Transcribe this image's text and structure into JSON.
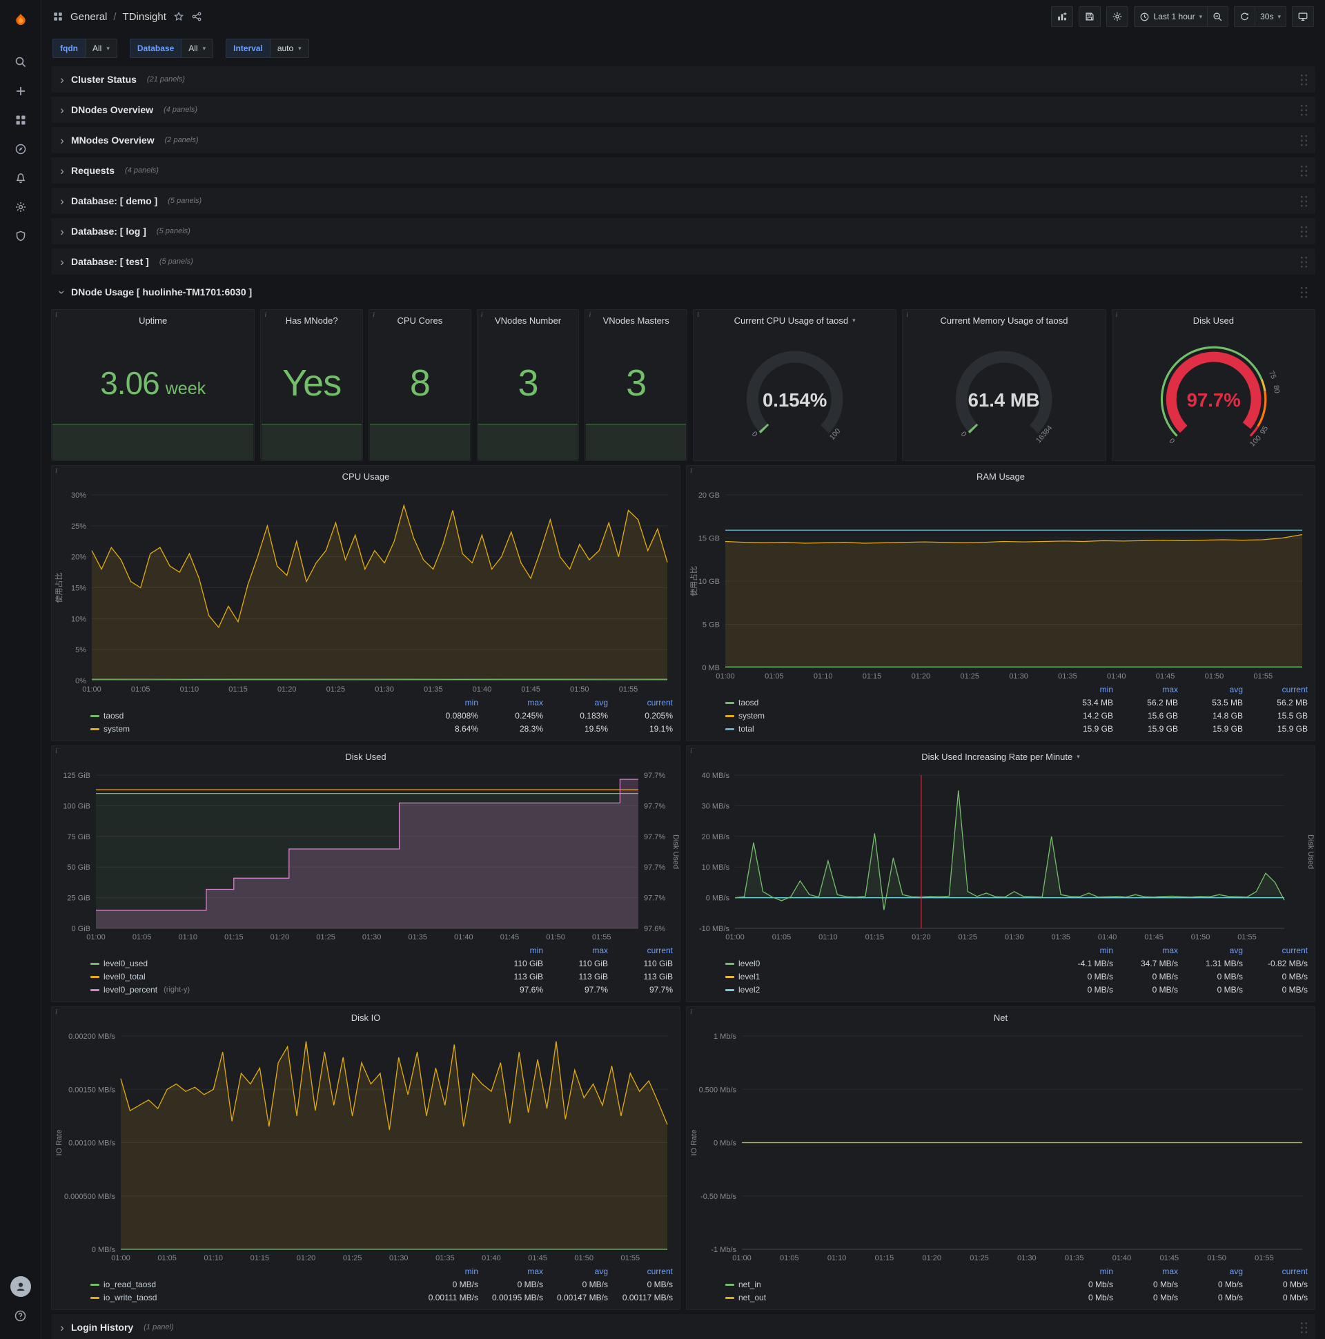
{
  "colors": {
    "green": "#73bf69",
    "yellow": "#e5ac0e",
    "blue": "#64b0c8",
    "cyan": "#6ed0e0",
    "orange": "#ff780a",
    "gold": "#eab839",
    "pink": "#d683ce",
    "red": "#e02f44",
    "header_blue": "#6e9fff",
    "axis_text": "#878b91"
  },
  "icons": {
    "chevron_right": "›",
    "caret_down": "▾",
    "panel_info": "i",
    "help": "?"
  },
  "navbar": {
    "breadcrumb_section": "General",
    "breadcrumb_sep": "/",
    "breadcrumb_page": "TDinsight",
    "time_range": "Last 1 hour",
    "refresh_interval": "30s"
  },
  "variables": [
    {
      "label": "fqdn",
      "value": "All"
    },
    {
      "label": "Database",
      "value": "All"
    },
    {
      "label": "Interval",
      "value": "auto"
    }
  ],
  "collapsed_rows": [
    {
      "title": "Cluster Status",
      "count": "(21 panels)"
    },
    {
      "title": "DNodes Overview",
      "count": "(4 panels)"
    },
    {
      "title": "MNodes Overview",
      "count": "(2 panels)"
    },
    {
      "title": "Requests",
      "count": "(4 panels)"
    },
    {
      "title": "Database: [ demo ]",
      "count": "(5 panels)"
    },
    {
      "title": "Database: [ log ]",
      "count": "(5 panels)"
    },
    {
      "title": "Database: [ test ]",
      "count": "(5 panels)"
    }
  ],
  "expanded_row": {
    "title": "DNode Usage [ huolinhe-TM1701:6030 ]"
  },
  "bottom_row": {
    "title": "Login History",
    "count": "(1 panel)"
  },
  "stats": [
    {
      "title": "Uptime",
      "value": "3.06",
      "unit": "week"
    },
    {
      "title": "Has MNode?",
      "value": "Yes",
      "unit": ""
    },
    {
      "title": "CPU Cores",
      "value": "8",
      "unit": ""
    },
    {
      "title": "VNodes Number",
      "value": "3",
      "unit": ""
    },
    {
      "title": "VNodes Masters",
      "value": "3",
      "unit": ""
    }
  ],
  "gauges": [
    {
      "title": "Current CPU Usage of taosd",
      "caret": true,
      "style": "simple",
      "value": "0.154%",
      "min_label": "0",
      "max_label": "100",
      "percent": 0.154,
      "value_color": "#d8d9da"
    },
    {
      "title": "Current Memory Usage of taosd",
      "caret": false,
      "style": "simple",
      "value": "61.4 MB",
      "min_label": "0",
      "max_label": "16384",
      "percent": 0.375,
      "value_color": "#d8d9da"
    },
    {
      "title": "Disk Used",
      "caret": false,
      "style": "threshold",
      "value": "97.7%",
      "percent": 97.7,
      "value_color": "#e02f44",
      "scale_labels": [
        {
          "v": 0,
          "t": "0"
        },
        {
          "v": 75,
          "t": "75"
        },
        {
          "v": 80,
          "t": "80"
        },
        {
          "v": 95,
          "t": "95"
        },
        {
          "v": 100,
          "t": "100"
        }
      ],
      "ring": [
        {
          "from": 0,
          "to": 75,
          "color": "#73bf69"
        },
        {
          "from": 75,
          "to": 80,
          "color": "#eab839"
        },
        {
          "from": 80,
          "to": 95,
          "color": "#ff780a"
        },
        {
          "from": 95,
          "to": 100,
          "color": "#e02f44"
        }
      ]
    }
  ],
  "charts": {
    "type": "line",
    "x_ticks": [
      "01:00",
      "01:05",
      "01:10",
      "01:15",
      "01:20",
      "01:25",
      "01:30",
      "01:35",
      "01:40",
      "01:45",
      "01:50",
      "01:55"
    ],
    "panels": [
      {
        "title": "CPU Usage",
        "y_label": "使用占比",
        "ml": 58,
        "mr": 18,
        "y_range": [
          0,
          30
        ],
        "y_ticks": [
          "30%",
          "25%",
          "20%",
          "15%",
          "10%",
          "5%",
          "0%"
        ],
        "series": [
          {
            "name": "system",
            "color": "#e5ac0e",
            "fill": 0.12,
            "data": [
              21,
              18,
              21.5,
              19.5,
              16,
              15,
              20.5,
              21.5,
              18.5,
              17.5,
              20.5,
              16.5,
              10.5,
              8.6,
              12,
              9.5,
              15.5,
              20,
              25,
              18.5,
              17,
              22.5,
              16,
              19,
              21,
              25.5,
              19.5,
              23.5,
              18,
              21,
              19,
              22.5,
              28.3,
              23,
              19.5,
              18,
              22,
              27.5,
              20.5,
              19,
              23.5,
              18,
              20,
              24,
              19,
              16.5,
              21,
              26,
              20,
              18,
              22,
              19.5,
              21,
              25.5,
              20,
              27.5,
              26,
              21,
              24.5,
              19.1
            ]
          },
          {
            "name": "taosd",
            "color": "#73bf69",
            "data": [
              0.2,
              0.21,
              0.19,
              0.2,
              0.2,
              0.21,
              0.2,
              0.19,
              0.2,
              0.2,
              0.21,
              0.2
            ]
          }
        ],
        "legend": {
          "cols": [
            "min",
            "max",
            "avg",
            "current"
          ],
          "rows": [
            {
              "name": "taosd",
              "color": "#73bf69",
              "vals": [
                "0.0808%",
                "0.245%",
                "0.183%",
                "0.205%"
              ]
            },
            {
              "name": "system",
              "color": "#e5ac0e",
              "vals": [
                "8.64%",
                "28.3%",
                "19.5%",
                "19.1%"
              ]
            }
          ]
        }
      },
      {
        "title": "RAM Usage",
        "y_label": "使用占比",
        "ml": 56,
        "mr": 18,
        "y_range": [
          0,
          20
        ],
        "y_ticks": [
          "20 GB",
          "15 GB",
          "10 GB",
          "5 GB",
          "0 MB"
        ],
        "series": [
          {
            "name": "system",
            "color": "#e5ac0e",
            "fill": 0.12,
            "data": [
              14.6,
              14.5,
              14.45,
              14.5,
              14.4,
              14.45,
              14.5,
              14.4,
              14.45,
              14.5,
              14.55,
              14.5,
              14.45,
              14.5,
              14.6,
              14.55,
              14.6,
              14.65,
              14.6,
              14.7,
              14.65,
              14.7,
              14.75,
              14.7,
              14.75,
              14.8,
              14.75,
              14.8,
              15.0,
              15.4
            ]
          },
          {
            "name": "total",
            "color": "#64b0c8",
            "data": [
              15.9,
              15.9
            ]
          },
          {
            "name": "taosd",
            "color": "#73bf69",
            "data": [
              0.055,
              0.055
            ]
          }
        ],
        "legend": {
          "cols": [
            "min",
            "max",
            "avg",
            "current"
          ],
          "rows": [
            {
              "name": "taosd",
              "color": "#73bf69",
              "vals": [
                "53.4 MB",
                "56.2 MB",
                "53.5 MB",
                "56.2 MB"
              ]
            },
            {
              "name": "system",
              "color": "#e5ac0e",
              "vals": [
                "14.2 GB",
                "15.6 GB",
                "14.8 GB",
                "15.5 GB"
              ]
            },
            {
              "name": "total",
              "color": "#64b0c8",
              "vals": [
                "15.9 GB",
                "15.9 GB",
                "15.9 GB",
                "15.9 GB"
              ]
            }
          ]
        }
      },
      {
        "title": "Disk Used",
        "ml": 64,
        "mr": 60,
        "y_range": [
          0,
          125
        ],
        "y_ticks": [
          "125 GiB",
          "100 GiB",
          "75 GiB",
          "50 GiB",
          "25 GiB",
          "0 GiB"
        ],
        "y2_range": [
          97.6,
          97.71
        ],
        "y2_ticks": [
          "97.7%",
          "97.7%",
          "97.7%",
          "97.7%",
          "97.7%",
          "97.6%"
        ],
        "y2_label": "Disk Used",
        "series": [
          {
            "name": "level0_used",
            "color": "#73bf69",
            "fill": 0.08,
            "data": [
              110,
              110
            ]
          },
          {
            "name": "level0_total",
            "color": "#e5ac0e",
            "data": [
              113,
              113
            ]
          },
          {
            "name": "level0_percent",
            "color": "#d683ce",
            "axis": "y2",
            "fill": 0.22,
            "step": true,
            "data": [
              97.613,
              97.613,
              97.613,
              97.613,
              97.613,
              97.613,
              97.613,
              97.613,
              97.613,
              97.613,
              97.613,
              97.613,
              97.628,
              97.628,
              97.628,
              97.636,
              97.636,
              97.636,
              97.636,
              97.636,
              97.636,
              97.657,
              97.657,
              97.657,
              97.657,
              97.657,
              97.657,
              97.657,
              97.657,
              97.657,
              97.657,
              97.657,
              97.657,
              97.69,
              97.69,
              97.69,
              97.69,
              97.69,
              97.69,
              97.69,
              97.69,
              97.69,
              97.69,
              97.69,
              97.69,
              97.69,
              97.69,
              97.69,
              97.69,
              97.69,
              97.69,
              97.69,
              97.69,
              97.69,
              97.69,
              97.69,
              97.69,
              97.707,
              97.707,
              97.707
            ]
          }
        ],
        "legend": {
          "cols": [
            "min",
            "max",
            "current"
          ],
          "rows": [
            {
              "name": "level0_used",
              "color": "#73bf69",
              "vals": [
                "110 GiB",
                "110 GiB",
                "110 GiB"
              ]
            },
            {
              "name": "level0_total",
              "color": "#e5ac0e",
              "vals": [
                "113 GiB",
                "113 GiB",
                "113 GiB"
              ]
            },
            {
              "name": "level0_percent",
              "suffix": "(right-y)",
              "color": "#d683ce",
              "vals": [
                "97.6%",
                "97.7%",
                "97.7%"
              ]
            }
          ]
        }
      },
      {
        "title": "Disk Used Increasing Rate per Minute",
        "caret": true,
        "ml": 70,
        "mr": 44,
        "y_range": [
          -10,
          40
        ],
        "y_ticks": [
          "40 MB/s",
          "30 MB/s",
          "20 MB/s",
          "10 MB/s",
          "0 MB/s",
          "-10 MB/s"
        ],
        "y2_label": "Disk Used",
        "annotation": 0.339,
        "series": [
          {
            "name": "level1",
            "color": "#eab839",
            "data": [
              0,
              0
            ]
          },
          {
            "name": "level2",
            "color": "#6ed0e0",
            "data": [
              0,
              0
            ]
          },
          {
            "name": "level0",
            "color": "#73bf69",
            "fill": 0.1,
            "data": [
              0,
              0.3,
              18,
              2,
              0.2,
              -1,
              0.3,
              5.5,
              1,
              0.2,
              12,
              1,
              0.3,
              0.2,
              0.4,
              21,
              -4,
              13,
              1,
              0.3,
              0.2,
              0.4,
              0.3,
              0.5,
              35,
              2,
              0.4,
              1.5,
              0.3,
              0.2,
              2,
              0.4,
              0.3,
              0.2,
              20,
              1,
              0.4,
              0.3,
              1.5,
              0.2,
              0.3,
              0.4,
              0.2,
              1,
              0.3,
              0.2,
              0.4,
              0.5,
              0.3,
              0.2,
              0.4,
              0.3,
              1,
              0.4,
              0.3,
              0.2,
              2,
              8,
              5,
              -0.8
            ]
          }
        ],
        "legend": {
          "cols": [
            "min",
            "max",
            "avg",
            "current"
          ],
          "rows": [
            {
              "name": "level0",
              "color": "#73bf69",
              "vals": [
                "-4.1 MB/s",
                "34.7 MB/s",
                "1.31 MB/s",
                "-0.82 MB/s"
              ]
            },
            {
              "name": "level1",
              "color": "#eab839",
              "vals": [
                "0 MB/s",
                "0 MB/s",
                "0 MB/s",
                "0 MB/s"
              ]
            },
            {
              "name": "level2",
              "color": "#6ed0e0",
              "vals": [
                "0 MB/s",
                "0 MB/s",
                "0 MB/s",
                "0 MB/s"
              ]
            }
          ]
        }
      },
      {
        "title": "Disk IO",
        "y_label": "IO Rate",
        "ml": 100,
        "mr": 18,
        "y_range": [
          0,
          0.002
        ],
        "y_ticks": [
          "0.00200 MB/s",
          "0.00150 MB/s",
          "0.00100 MB/s",
          "0.000500 MB/s",
          "0 MB/s"
        ],
        "series": [
          {
            "name": "io_write_taosd",
            "color": "#e5ac0e",
            "fill": 0.12,
            "data": [
              0.0016,
              0.0013,
              0.00135,
              0.0014,
              0.00132,
              0.0015,
              0.00155,
              0.00148,
              0.00152,
              0.00145,
              0.0015,
              0.00185,
              0.0012,
              0.00165,
              0.00155,
              0.0017,
              0.00115,
              0.00175,
              0.0019,
              0.00125,
              0.00195,
              0.0013,
              0.00185,
              0.00135,
              0.0018,
              0.00125,
              0.00175,
              0.00155,
              0.00165,
              0.00112,
              0.0018,
              0.00145,
              0.00185,
              0.00125,
              0.0017,
              0.00135,
              0.00192,
              0.00115,
              0.00165,
              0.00155,
              0.00148,
              0.00175,
              0.00118,
              0.00185,
              0.00128,
              0.00178,
              0.00132,
              0.00195,
              0.00122,
              0.00168,
              0.00142,
              0.00155,
              0.00135,
              0.00172,
              0.00125,
              0.00165,
              0.00148,
              0.00158,
              0.00138,
              0.00117
            ]
          },
          {
            "name": "io_read_taosd",
            "color": "#73bf69",
            "data": [
              0,
              0
            ]
          }
        ],
        "legend": {
          "cols": [
            "min",
            "max",
            "avg",
            "current"
          ],
          "rows": [
            {
              "name": "io_read_taosd",
              "color": "#73bf69",
              "vals": [
                "0 MB/s",
                "0 MB/s",
                "0 MB/s",
                "0 MB/s"
              ]
            },
            {
              "name": "io_write_taosd",
              "color": "#e5ac0e",
              "vals": [
                "0.00111 MB/s",
                "0.00195 MB/s",
                "0.00147 MB/s",
                "0.00117 MB/s"
              ]
            }
          ]
        }
      },
      {
        "title": "Net",
        "y_label": "IO Rate",
        "ml": 80,
        "mr": 18,
        "y_range": [
          -1,
          1
        ],
        "y_ticks": [
          "1 Mb/s",
          "0.500 Mb/s",
          "0 Mb/s",
          "-0.50 Mb/s",
          "-1 Mb/s"
        ],
        "series": [
          {
            "name": "net_in",
            "color": "#73bf69",
            "data": [
              0,
              0
            ]
          },
          {
            "name": "net_out",
            "color": "#e5ac0e",
            "data": [
              0,
              0
            ]
          }
        ],
        "legend": {
          "cols": [
            "min",
            "max",
            "avg",
            "current"
          ],
          "rows": [
            {
              "name": "net_in",
              "color": "#73bf69",
              "vals": [
                "0 Mb/s",
                "0 Mb/s",
                "0 Mb/s",
                "0 Mb/s"
              ]
            },
            {
              "name": "net_out",
              "color": "#e5ac0e",
              "vals": [
                "0 Mb/s",
                "0 Mb/s",
                "0 Mb/s",
                "0 Mb/s"
              ]
            }
          ]
        }
      }
    ]
  }
}
